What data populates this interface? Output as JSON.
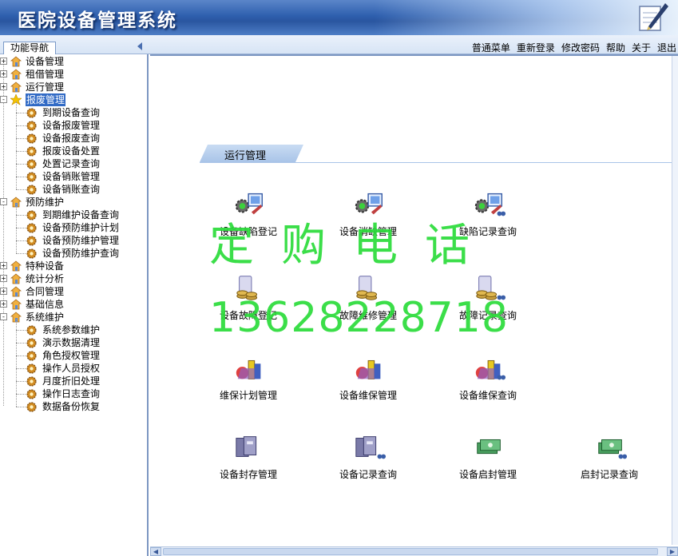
{
  "app": {
    "title": "医院设备管理系统"
  },
  "toolbar": {
    "nav_tab": "功能导航",
    "links": [
      "普通菜单",
      "重新登录",
      "修改密码",
      "帮助",
      "关于",
      "退出"
    ]
  },
  "sidebar": {
    "nodes": [
      {
        "label": "设备管理",
        "level": 0,
        "expander": "+"
      },
      {
        "label": "租借管理",
        "level": 0,
        "expander": "+"
      },
      {
        "label": "运行管理",
        "level": 0,
        "expander": "+"
      },
      {
        "label": "报废管理",
        "level": 0,
        "expander": "-",
        "selected": true
      },
      {
        "label": "到期设备查询",
        "level": 1
      },
      {
        "label": "设备报废管理",
        "level": 1
      },
      {
        "label": "设备报废查询",
        "level": 1
      },
      {
        "label": "报废设备处置",
        "level": 1
      },
      {
        "label": "处置记录查询",
        "level": 1
      },
      {
        "label": "设备销账管理",
        "level": 1
      },
      {
        "label": "设备销账查询",
        "level": 1
      },
      {
        "label": "预防维护",
        "level": 0,
        "expander": "-"
      },
      {
        "label": "到期维护设备查询",
        "level": 1
      },
      {
        "label": "设备预防维护计划",
        "level": 1
      },
      {
        "label": "设备预防维护管理",
        "level": 1
      },
      {
        "label": "设备预防维护查询",
        "level": 1
      },
      {
        "label": "特种设备",
        "level": 0,
        "expander": "+"
      },
      {
        "label": "统计分析",
        "level": 0,
        "expander": "+"
      },
      {
        "label": "合同管理",
        "level": 0,
        "expander": "+"
      },
      {
        "label": "基础信息",
        "level": 0,
        "expander": "+"
      },
      {
        "label": "系统维护",
        "level": 0,
        "expander": "-"
      },
      {
        "label": "系统参数维护",
        "level": 1
      },
      {
        "label": "演示数据清理",
        "level": 1
      },
      {
        "label": "角色授权管理",
        "level": 1
      },
      {
        "label": "操作人员授权",
        "level": 1
      },
      {
        "label": "月度折旧处理",
        "level": 1
      },
      {
        "label": "操作日志查询",
        "level": 1
      },
      {
        "label": "数据备份恢复",
        "level": 1
      }
    ]
  },
  "main": {
    "section_title": "运行管理",
    "functions": [
      {
        "label": "设备缺陷登记",
        "icon": "gear-monitor-icon"
      },
      {
        "label": "设备消缺管理",
        "icon": "gear-monitor-icon"
      },
      {
        "label": "缺陷记录查询",
        "icon": "gear-monitor-search-icon"
      },
      {
        "label": "设备故障登记",
        "icon": "coins-tablet-icon"
      },
      {
        "label": "故障维修管理",
        "icon": "coins-tablet-icon"
      },
      {
        "label": "故障记录查询",
        "icon": "coins-tablet-search-icon"
      },
      {
        "label": "维保计划管理",
        "icon": "maintenance-icon"
      },
      {
        "label": "设备维保管理",
        "icon": "maintenance-icon"
      },
      {
        "label": "设备维保查询",
        "icon": "maintenance-search-icon"
      },
      {
        "label": "设备封存管理",
        "icon": "archive-icon"
      },
      {
        "label": "设备记录查询",
        "icon": "archive-search-icon"
      },
      {
        "label": "设备启封管理",
        "icon": "money-icon"
      },
      {
        "label": "启封记录查询",
        "icon": "money-search-icon"
      }
    ]
  },
  "watermark": {
    "line1": "定购电话",
    "line2": "13628228718"
  },
  "colors": {
    "banner": "#2e5fae",
    "selected": "#316ac5",
    "watermark": "#2bdc3a"
  }
}
